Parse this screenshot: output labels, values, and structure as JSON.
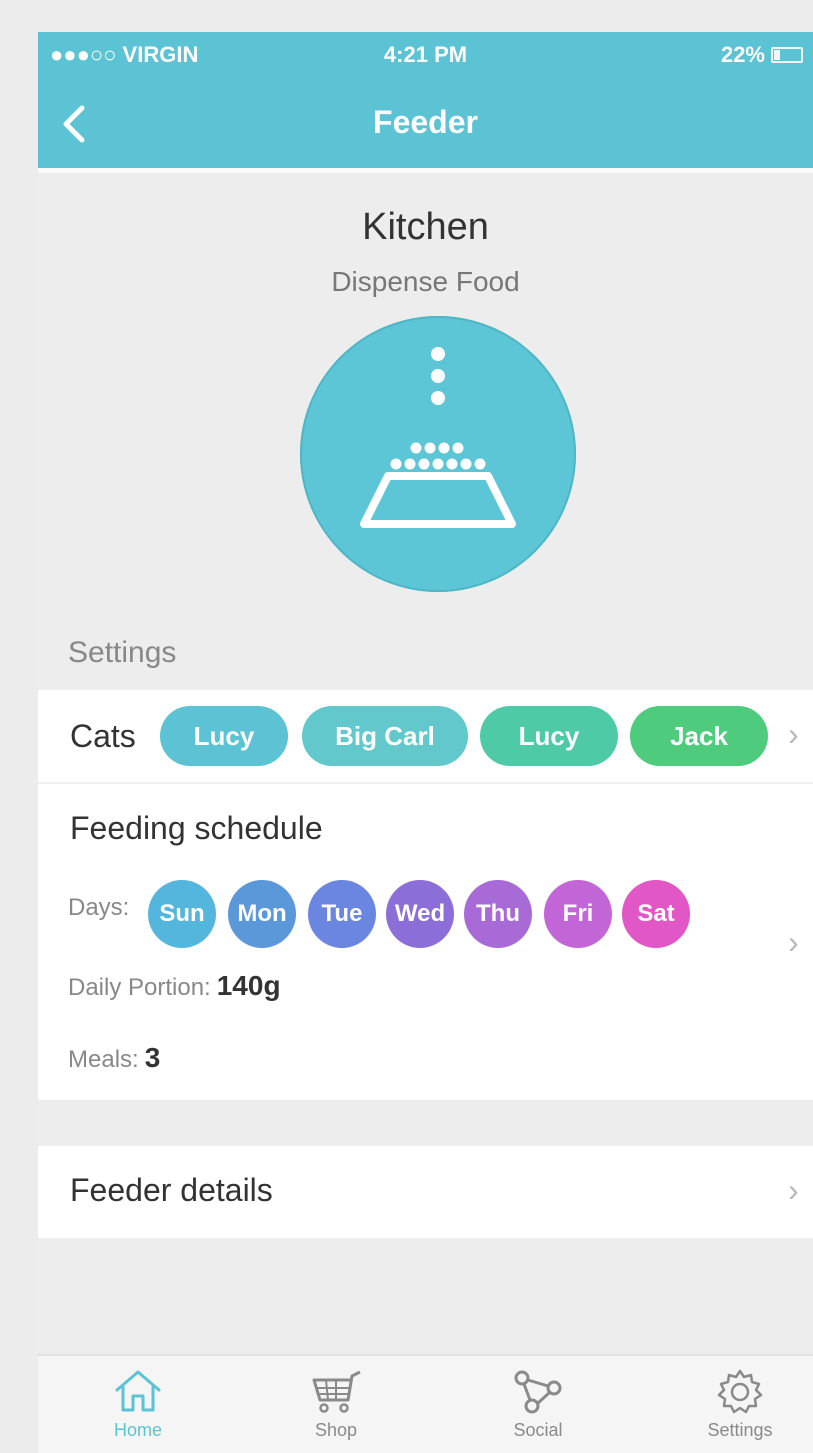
{
  "status_bar": {
    "carrier": "●●●○○ VIRGIN",
    "time": "4:21 PM",
    "battery": "22%"
  },
  "nav": {
    "title": "Feeder"
  },
  "device": {
    "name": "Kitchen",
    "action_label": "Dispense Food"
  },
  "settings": {
    "section_label": "Settings",
    "cats_label": "Cats",
    "cats": [
      {
        "name": "Lucy",
        "color": "#5bc3d3"
      },
      {
        "name": "Big Carl",
        "color": "#62c8cc"
      },
      {
        "name": "Lucy",
        "color": "#4fcaa7"
      },
      {
        "name": "Jack",
        "color": "#4ecb7c"
      }
    ],
    "schedule_title": "Feeding schedule",
    "days_label": "Days:",
    "days": [
      {
        "label": "Sun",
        "color": "#54b6dc"
      },
      {
        "label": "Mon",
        "color": "#5a98da"
      },
      {
        "label": "Tue",
        "color": "#6b86e0"
      },
      {
        "label": "Wed",
        "color": "#8b6ed8"
      },
      {
        "label": "Thu",
        "color": "#a76ad6"
      },
      {
        "label": "Fri",
        "color": "#c265d6"
      },
      {
        "label": "Sat",
        "color": "#e157c6"
      }
    ],
    "portion_label": "Daily Portion:",
    "portion_value": "140g",
    "meals_label": "Meals:",
    "meals_value": "3"
  },
  "feeder_details": {
    "label": "Feeder details"
  },
  "tabs": [
    {
      "label": "Home",
      "icon": "home-icon",
      "active": true
    },
    {
      "label": "Shop",
      "icon": "cart-icon",
      "active": false
    },
    {
      "label": "Social",
      "icon": "social-icon",
      "active": false
    },
    {
      "label": "Settings",
      "icon": "gear-icon",
      "active": false
    }
  ],
  "colors": {
    "accent": "#5bc3d3",
    "background": "#ededed"
  }
}
